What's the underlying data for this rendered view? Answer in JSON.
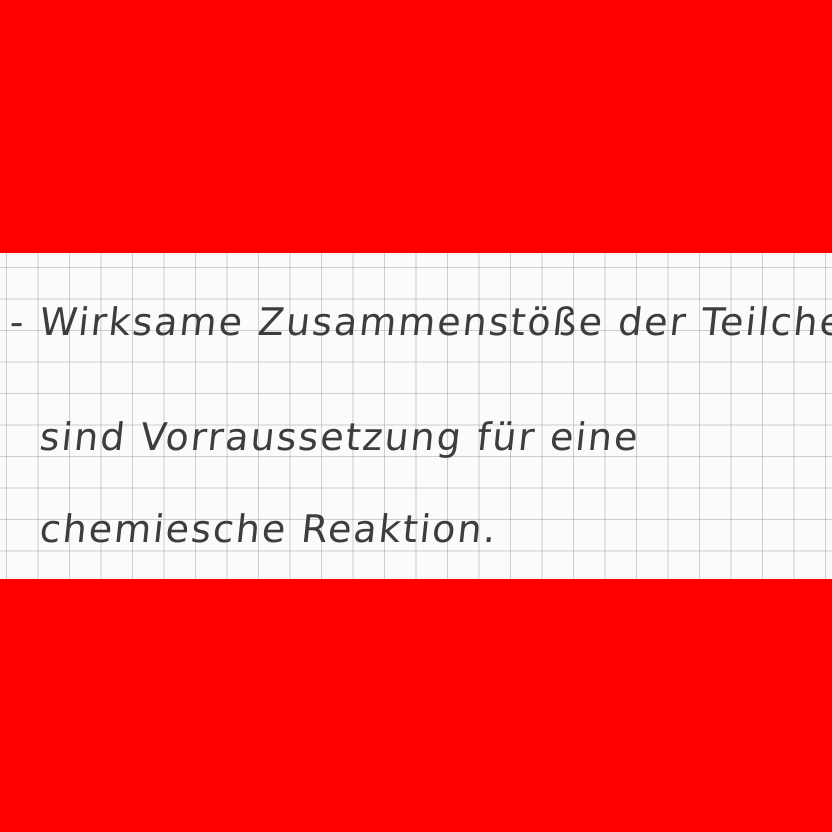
{
  "colors": {
    "band": "#ff0000",
    "paper": "#fbfbfb",
    "ink": "#3d3d3d",
    "grid": "#969696"
  },
  "note": {
    "lines": [
      "- Wirksame Zusammenstöße der Teilchen",
      "sind Vorraussetzung für eine",
      "chemiesche Reaktion."
    ]
  }
}
